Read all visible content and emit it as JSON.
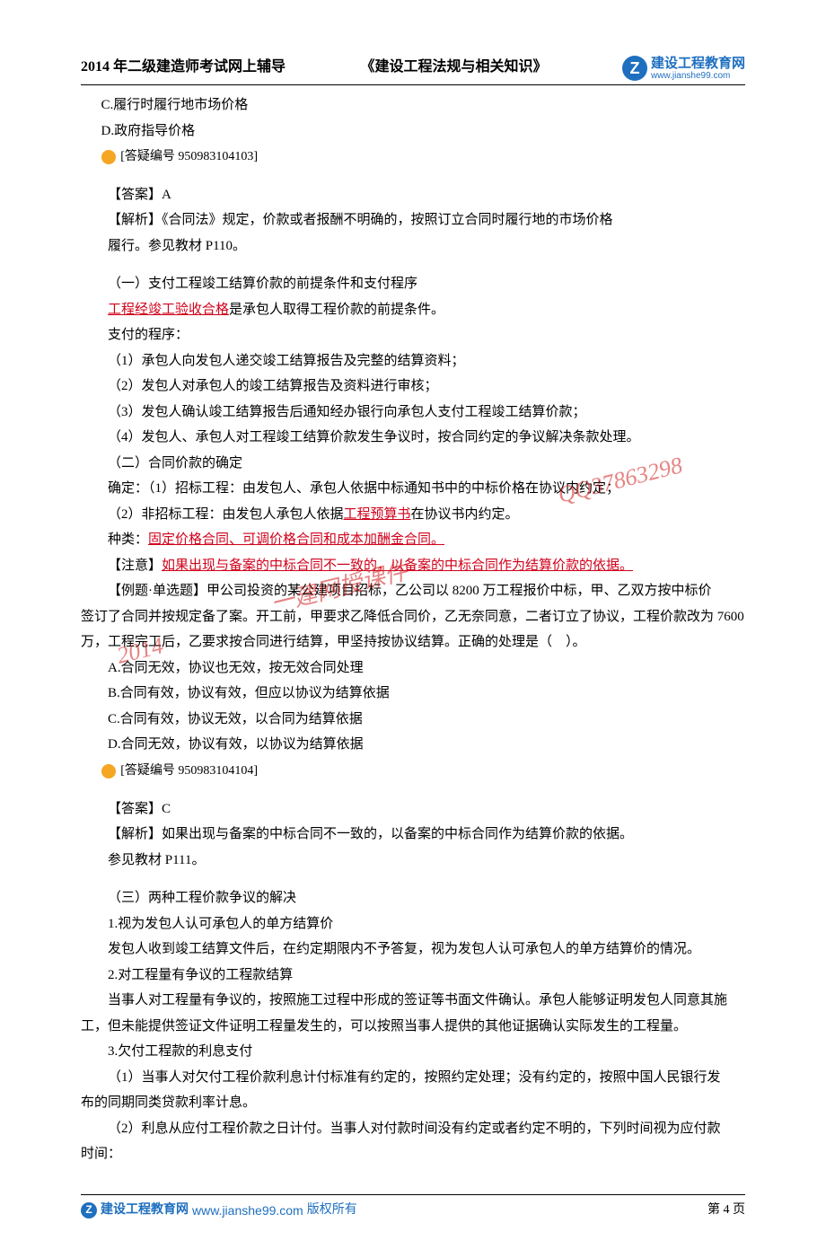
{
  "header": {
    "title_left": "2014 年二级建造师考试网上辅导",
    "title_mid": "《建设工程法规与相关知识》",
    "logo_brand": "建设工程教育网",
    "logo_url": "www.jianshe99.com",
    "logo_letter": "Z"
  },
  "body": {
    "opt_c": "C.履行时履行地市场价格",
    "opt_d": "D.政府指导价格",
    "q1_id": "[答疑编号 950983104103]",
    "ans1": "【答案】A",
    "exp1a": "【解析】《合同法》规定，价款或者报酬不明确的，按照订立合同时履行地的市场价格",
    "exp1b": "履行。参见教材 P110。",
    "sec1_title": "（一）支付工程竣工结算价款的前提条件和支付程序",
    "sec1_red": "工程经竣工验收合格",
    "sec1_tail": "是承包人取得工程价款的前提条件。",
    "sec1_p": "支付的程序：",
    "sec1_i1": "（1）承包人向发包人递交竣工结算报告及完整的结算资料；",
    "sec1_i2": "（2）发包人对承包人的竣工结算报告及资料进行审核；",
    "sec1_i3": "（3）发包人确认竣工结算报告后通知经办银行向承包人支付工程竣工结算价款；",
    "sec1_i4": "（4）发包人、承包人对工程竣工结算价款发生争议时，按合同约定的争议解决条款处理。",
    "sec2_title": "（二）合同价款的确定",
    "sec2_i1": "确定：（1）招标工程：由发包人、承包人依据中标通知书中的中标价格在协议内约定；",
    "sec2_i2a": "（2）非招标工程：由发包人承包人依据",
    "sec2_i2_red": "工程预算书",
    "sec2_i2b": "在协议书内约定。",
    "sec2_kind_a": "种类：",
    "sec2_kind_red": "固定价格合同、可调价格合同和成本加酬金合同。",
    "note_a": "【注意】",
    "note_red": "如果出现与备案的中标合同不一致的，以备案的中标合同作为结算价款的依据。",
    "ex_l1": "【例题·单选题】甲公司投资的某公建项目招标，乙公司以 8200 万工程报价中标，甲、乙双方按中标价",
    "ex_l2": "签订了合同并按规定备了案。开工前，甲要求乙降低合同价，乙无奈同意，二者订立了协议，工程价款改为 7600",
    "ex_l3": "万，工程完工后，乙要求按合同进行结算，甲坚持按协议结算。正确的处理是（　）。",
    "ex_a": "A.合同无效，协议也无效，按无效合同处理",
    "ex_b": "B.合同有效，协议有效，但应以协议为结算依据",
    "ex_c": "C.合同有效，协议无效，以合同为结算依据",
    "ex_d": "D.合同无效，协议有效，以协议为结算依据",
    "q2_id": "[答疑编号 950983104104]",
    "ans2": "【答案】C",
    "exp2a": "【解析】如果出现与备案的中标合同不一致的，以备案的中标合同作为结算价款的依据。",
    "exp2b": "参见教材 P111。",
    "sec3_title": "（三）两种工程价款争议的解决",
    "sec3_h1": "1.视为发包人认可承包人的单方结算价",
    "sec3_p1": "发包人收到竣工结算文件后，在约定期限内不予答复，视为发包人认可承包人的单方结算价的情况。",
    "sec3_h2": "2.对工程量有争议的工程款结算",
    "sec3_p2a": "当事人对工程量有争议的，按照施工过程中形成的签证等书面文件确认。承包人能够证明发包人同意其施",
    "sec3_p2b": "工，但未能提供签证文件证明工程量发生的，可以按照当事人提供的其他证据确认实际发生的工程量。",
    "sec3_h3": "3.欠付工程款的利息支付",
    "sec3_p3a": "（1）当事人对欠付工程价款利息计付标准有约定的，按照约定处理；没有约定的，按照中国人民银行发",
    "sec3_p3b": "布的同期同类贷款利率计息。",
    "sec3_p4a": "（2）利息从应付工程价款之日计付。当事人对付款时间没有约定或者约定不明的，下列时间视为应付款",
    "sec3_p4b": "时间："
  },
  "watermark": {
    "w1": "QQ37863298",
    "w2": "一建网授课件",
    "w3": "2014"
  },
  "footer": {
    "brand": "建设工程教育网",
    "url": "www.jianshe99.com",
    "rights": "版权所有",
    "page": "第 4 页",
    "logo_letter": "Z"
  }
}
